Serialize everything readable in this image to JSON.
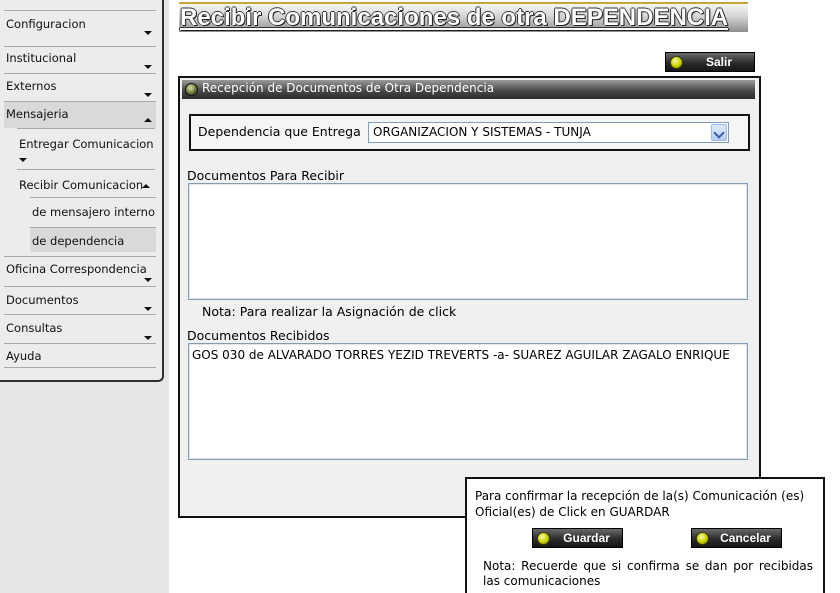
{
  "sidebar": {
    "items": [
      {
        "label": "Configuracion"
      },
      {
        "label": "Institucional"
      },
      {
        "label": "Externos"
      },
      {
        "label": "Mensajeria"
      },
      {
        "label": "Entregar Comunicacion"
      },
      {
        "label": "Recibir Comunicacion"
      },
      {
        "label": "de mensajero interno"
      },
      {
        "label": "de dependencia"
      },
      {
        "label": "Oficina Correspondencia"
      },
      {
        "label": "Documentos"
      },
      {
        "label": "Consultas"
      },
      {
        "label": "Ayuda"
      }
    ]
  },
  "page": {
    "title": "Recibir Comunicaciones de otra DEPENDENCIA",
    "exit_button": "Salir"
  },
  "panel": {
    "header": "Recepción de Documentos de Otra Dependencia",
    "dependency_label": "Dependencia que Entrega",
    "dependency_selected": "ORGANIZACION Y SISTEMAS - TUNJA",
    "to_receive_label": "Documentos Para Recibir",
    "to_receive_items": [],
    "note": "Nota: Para realizar la Asignación de click",
    "received_label": "Documentos Recibidos",
    "received_items": [
      "GOS 030 de ALVARADO TORRES YEZID TREVERTS -a- SUAREZ AGUILAR ZAGALO ENRIQUE"
    ]
  },
  "confirm": {
    "text": "Para confirmar la recepción de la(s) Comunicación (es) Oficial(es) de Click en GUARDAR",
    "save_button": "Guardar",
    "cancel_button": "Cancelar",
    "note": "Nota: Recuerde que si confirma se dan por recibidas las comunicaciones"
  }
}
